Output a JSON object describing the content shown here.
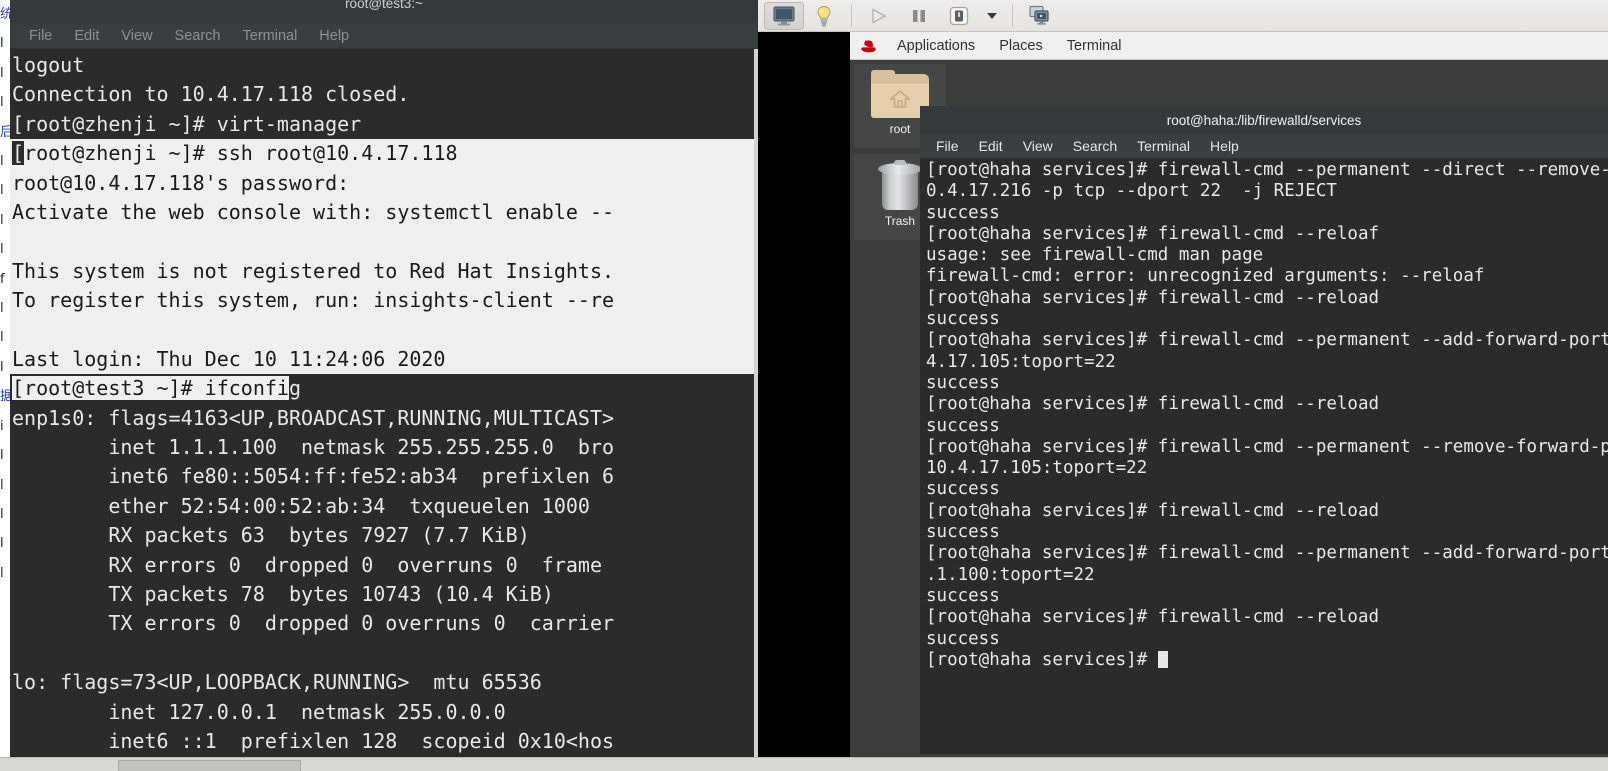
{
  "background_sliver": {
    "lines": [
      "统",
      "l",
      "l",
      "l",
      "后",
      "l",
      "l",
      "l",
      "l",
      "f",
      "l",
      "l",
      "l",
      "l",
      "l",
      "据",
      "i",
      "l",
      "l",
      "l",
      "l",
      "l",
      "l"
    ]
  },
  "left_terminal": {
    "title": "root@test3:~",
    "menu": [
      "File",
      "Edit",
      "View",
      "Search",
      "Terminal",
      "Help"
    ],
    "lines": [
      {
        "text": "logout",
        "selected": false
      },
      {
        "text": "Connection to 10.4.17.118 closed.",
        "selected": false
      },
      {
        "text": "[root@zhenji ~]# virt-manager",
        "selected": false
      },
      {
        "text": "[root@zhenji ~]# ssh root@10.4.17.118",
        "selected": true,
        "lead_dark": "["
      },
      {
        "text": "root@10.4.17.118's password:",
        "selected": true
      },
      {
        "text": "Activate the web console with: systemctl enable --",
        "selected": true
      },
      {
        "text": "",
        "selected": true
      },
      {
        "text": "This system is not registered to Red Hat Insights.",
        "selected": true
      },
      {
        "text": "To register this system, run: insights-client --re",
        "selected": true
      },
      {
        "text": "",
        "selected": true
      },
      {
        "text": "Last login: Thu Dec 10 11:24:06 2020",
        "selected": true
      },
      {
        "text": "[root@test3 ~]# ifconfi",
        "tail": "g",
        "selected": "partial"
      },
      {
        "text": "enp1s0: flags=4163<UP,BROADCAST,RUNNING,MULTICAST>",
        "selected": false
      },
      {
        "text": "        inet 1.1.1.100  netmask 255.255.255.0  bro",
        "selected": false
      },
      {
        "text": "        inet6 fe80::5054:ff:fe52:ab34  prefixlen 6",
        "selected": false
      },
      {
        "text": "        ether 52:54:00:52:ab:34  txqueuelen 1000",
        "selected": false
      },
      {
        "text": "        RX packets 63  bytes 7927 (7.7 KiB)",
        "selected": false
      },
      {
        "text": "        RX errors 0  dropped 0  overruns 0  frame",
        "selected": false
      },
      {
        "text": "        TX packets 78  bytes 10743 (10.4 KiB)",
        "selected": false
      },
      {
        "text": "        TX errors 0  dropped 0 overruns 0  carrier",
        "selected": false
      },
      {
        "text": "",
        "selected": false
      },
      {
        "text": "lo: flags=73<UP,LOOPBACK,RUNNING>  mtu 65536",
        "selected": false
      },
      {
        "text": "        inet 127.0.0.1  netmask 255.0.0.0",
        "selected": false
      },
      {
        "text": "        inet6 ::1  prefixlen 128  scopeid 0x10<hos",
        "selected": false
      }
    ]
  },
  "vm_console": {
    "toolbar": {
      "console_view": "console-view",
      "details_view": "details-view",
      "run": "run",
      "pause": "pause",
      "shutdown": "shutdown",
      "shutdown_menu": "shutdown-options",
      "fullscreen": "fullscreen"
    },
    "guest": {
      "panel": {
        "logo": "redhat-logo",
        "items": [
          "Applications",
          "Places",
          "Terminal"
        ]
      },
      "desktop_icons": [
        {
          "name": "home-folder",
          "label": "root"
        },
        {
          "name": "trash",
          "label": "Trash"
        }
      ]
    }
  },
  "right_terminal": {
    "title": "root@haha:/lib/firewalld/services",
    "menu": [
      "File",
      "Edit",
      "View",
      "Search",
      "Terminal",
      "Help"
    ],
    "lines": [
      "[root@haha services]# firewall-cmd --permanent --direct --remove-ru",
      "0.4.17.216 -p tcp --dport 22  -j REJECT",
      "success",
      "[root@haha services]# firewall-cmd --reloaf",
      "usage: see firewall-cmd man page",
      "firewall-cmd: error: unrecognized arguments: --reloaf",
      "[root@haha services]# firewall-cmd --reload",
      "success",
      "[root@haha services]# firewall-cmd --permanent --add-forward-port=p",
      "4.17.105:toport=22",
      "success",
      "[root@haha services]# firewall-cmd --reload",
      "success",
      "[root@haha services]# firewall-cmd --permanent --remove-forward-po",
      "10.4.17.105:toport=22",
      "success",
      "[root@haha services]# firewall-cmd --reload",
      "success",
      "[root@haha services]# firewall-cmd --permanent --add-forward-port=p",
      ".1.100:toport=22",
      "success",
      "[root@haha services]# firewall-cmd --reload",
      "success"
    ],
    "prompt": "[root@haha services]# "
  },
  "colors": {
    "terminal_bg": "#2b2b2b",
    "terminal_fg": "#e8e8e8",
    "selection_bg": "#efefef",
    "selection_fg": "#1a1a1a",
    "titlebar_bg": "#343a3b",
    "panel_bg": "#efefed",
    "redhat_red": "#cc0000",
    "desktop_bg": "#3b3c3c"
  }
}
